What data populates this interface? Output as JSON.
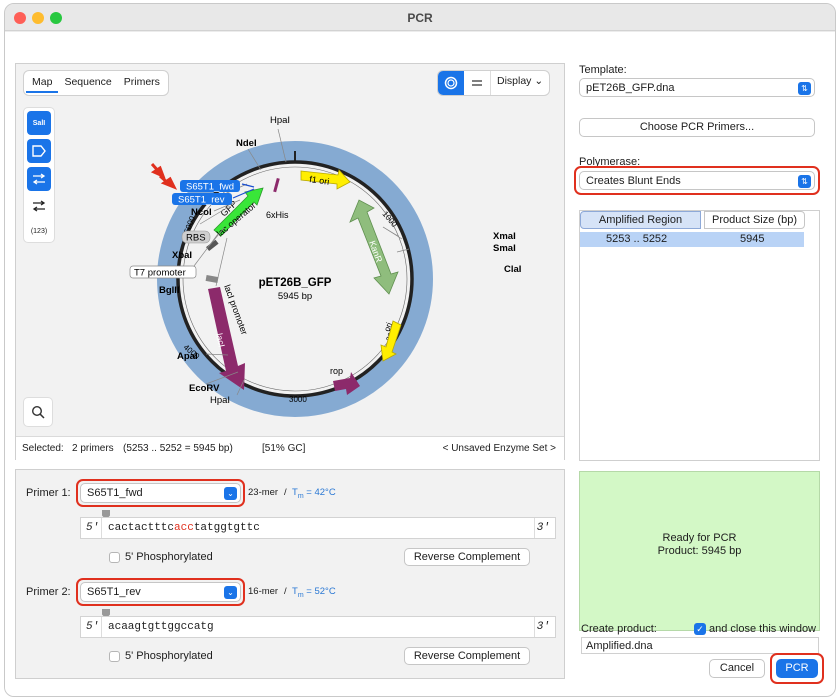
{
  "window": {
    "title": "PCR"
  },
  "map_panel": {
    "tabs": [
      "Map",
      "Sequence",
      "Primers"
    ],
    "active_tab": "Map",
    "display_label": "Display",
    "tool_counter": "(123)",
    "plasmid_name": "pET26B_GFP",
    "plasmid_size": "5945 bp",
    "enzymes": {
      "hpai_top": "HpaI",
      "ndei": "NdeI",
      "ncoi": "NcoI",
      "xbai": "XbaI",
      "bglii": "BglII",
      "xmai": "XmaI",
      "smai": "SmaI",
      "clai": "ClaI",
      "apai": "ApaI",
      "ecorv": "EcoRV",
      "hpai_bottom": "HpaI"
    },
    "features": {
      "gfp": "GFP",
      "lac_operator": "lac operator",
      "his": "6xHis",
      "f1_ori": "f1 ori",
      "kanr": "KanR",
      "ori": "ori",
      "rop": "rop",
      "laci": "lacI",
      "laci_promoter": "lacI promoter",
      "rbs": "RBS",
      "t7_promoter": "T7 promoter"
    },
    "primer_labels": {
      "fwd": "S65T1_fwd",
      "rev": "S65T1_rev"
    },
    "ticks": {
      "t1000": "1000",
      "t2000": "2000",
      "t3000": "3000",
      "t4000": "4000",
      "t5000": "5000"
    },
    "status": {
      "selected_label": "Selected:",
      "selected_value": "2 primers",
      "range": "(5253 .. 5252 = 5945 bp)",
      "gc": "[51% GC]",
      "enzyme_set": "< Unsaved Enzyme Set >"
    }
  },
  "primers": {
    "primer1": {
      "label": "Primer 1:",
      "name": "S65T1_fwd",
      "mer": "23-mer",
      "tm_label": "T",
      "tm_sub": "m",
      "tm_value": " = 42°C",
      "five": "5'",
      "three": "3'",
      "seq_a": "cactactttc",
      "seq_b": "acc",
      "seq_c": "tatggtgttc",
      "phos": "5' Phosphorylated",
      "revcomp": "Reverse Complement"
    },
    "primer2": {
      "label": "Primer 2:",
      "name": "S65T1_rev",
      "mer": "16-mer",
      "tm_label": "T",
      "tm_sub": "m",
      "tm_value": " = 52°C",
      "five": "5'",
      "three": "3'",
      "seq": "acaagtgttggccatg",
      "phos": "5' Phosphorylated",
      "revcomp": "Reverse Complement"
    },
    "separator": "/"
  },
  "right": {
    "template_label": "Template:",
    "template_value": "pET26B_GFP.dna",
    "choose_button": "Choose PCR Primers...",
    "polymerase_label": "Polymerase:",
    "polymerase_value": "Creates Blunt Ends",
    "result_tabs": [
      "Amplified Region",
      "Product Size (bp)"
    ],
    "result_row": {
      "region": "5253  ..  5252",
      "size": "5945"
    },
    "ready_line1": "Ready for PCR",
    "ready_line2": "Product:  5945 bp",
    "create_label": "Create product:",
    "close_label": "and close this window",
    "filename": "Amplified.dna",
    "cancel": "Cancel",
    "pcr": "PCR"
  },
  "colors": {
    "accent": "#1a74e8",
    "highlight_red": "#e0301e",
    "gfp": "#39e639",
    "f1ori": "#ffee00",
    "kanr": "#8fbd7d",
    "laci": "#8c2a6b",
    "backbone": "#85aad2",
    "ready_bg": "#d3f8c6"
  }
}
